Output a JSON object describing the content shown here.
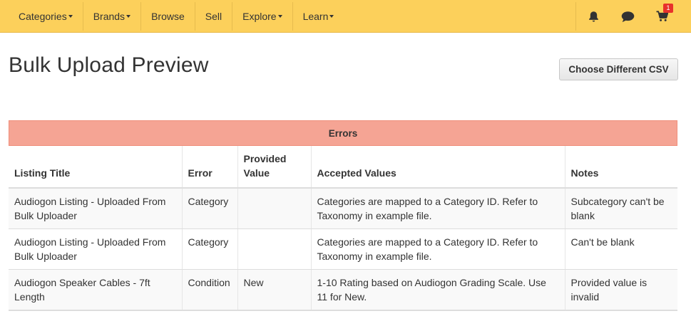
{
  "nav": {
    "items": [
      {
        "label": "Categories",
        "dropdown": true
      },
      {
        "label": "Brands",
        "dropdown": true
      },
      {
        "label": "Browse",
        "dropdown": false
      },
      {
        "label": "Sell",
        "dropdown": false
      },
      {
        "label": "Explore",
        "dropdown": true
      },
      {
        "label": "Learn",
        "dropdown": true
      }
    ],
    "icons": [
      "bell-icon",
      "chat-bubble-icon",
      "cart-icon"
    ],
    "cart_count": "1"
  },
  "page": {
    "title": "Bulk Upload Preview",
    "choose_csv_label": "Choose Different CSV"
  },
  "errors_table": {
    "section_title": "Errors",
    "columns": [
      "Listing Title",
      "Error",
      "Provided Value",
      "Accepted Values",
      "Notes"
    ],
    "rows": [
      {
        "listing_title": "Audiogon Listing - Uploaded From Bulk Uploader",
        "error": "Category",
        "provided_value": "",
        "accepted_values": "Categories are mapped to a Category ID. Refer to Taxonomy in example file.",
        "notes": "Subcategory can't be blank"
      },
      {
        "listing_title": "Audiogon Listing - Uploaded From Bulk Uploader",
        "error": "Category",
        "provided_value": "",
        "accepted_values": "Categories are mapped to a Category ID. Refer to Taxonomy in example file.",
        "notes": "Can't be blank"
      },
      {
        "listing_title": "Audiogon Speaker Cables - 7ft Length",
        "error": "Condition",
        "provided_value": "New",
        "accepted_values": "1-10 Rating based on Audiogon Grading Scale. Use 11 for New.",
        "notes": "Provided value is invalid"
      }
    ]
  },
  "colors": {
    "navbar": "#fcd05b",
    "errors_header": "#f5a494",
    "badge": "#e8312b"
  }
}
